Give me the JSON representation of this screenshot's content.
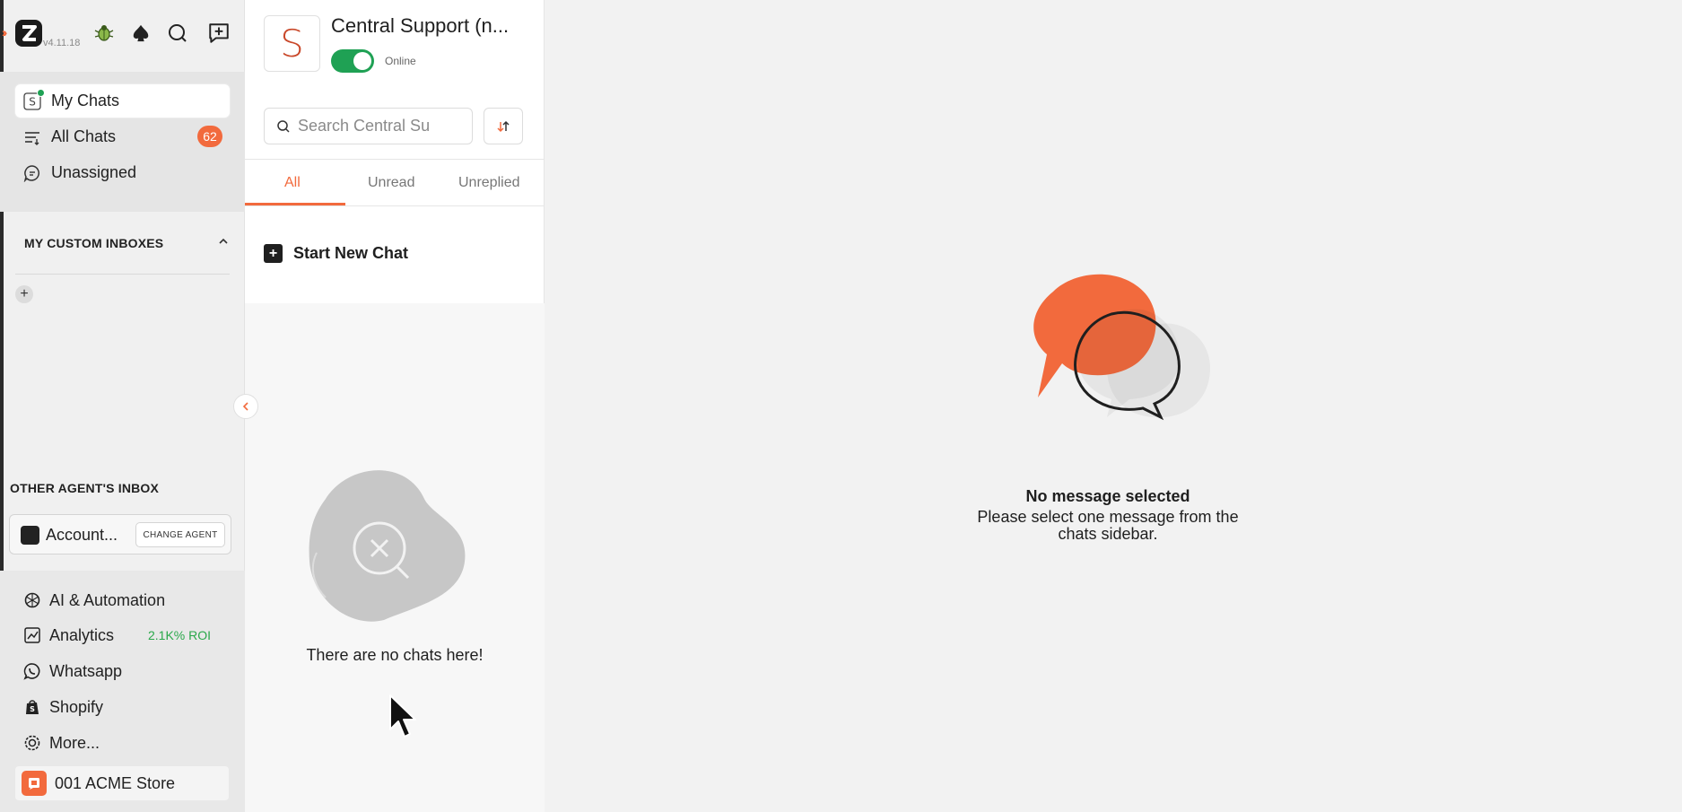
{
  "app": {
    "version": "v4.11.18"
  },
  "nav": {
    "my_chats": "My Chats",
    "all_chats": "All Chats",
    "all_chats_count": "62",
    "unassigned": "Unassigned"
  },
  "custom_inboxes": {
    "header": "MY CUSTOM INBOXES"
  },
  "other_agents": {
    "header": "OTHER AGENT'S INBOX",
    "agent_name": "Account...",
    "change_agent_label": "CHANGE AGENT"
  },
  "bottom_nav": {
    "ai_automation": "AI & Automation",
    "analytics": "Analytics",
    "analytics_roi": "2.1K% ROI",
    "whatsapp": "Whatsapp",
    "shopify": "Shopify",
    "more": "More...",
    "store": "001 ACME Store"
  },
  "inbox": {
    "avatar_letter": "S",
    "title": "Central Support (n...",
    "status": "Online",
    "search_placeholder": "Search Central Su",
    "tabs": [
      "All",
      "Unread",
      "Unreplied"
    ],
    "start_new_chat": "Start New Chat",
    "empty_text": "There are no chats here!"
  },
  "detail": {
    "empty_title": "No message selected",
    "empty_subtitle": "Please select one message from the chats sidebar."
  },
  "colors": {
    "accent": "#f26a3d",
    "online": "#1fa154",
    "roi": "#2aa84a"
  }
}
